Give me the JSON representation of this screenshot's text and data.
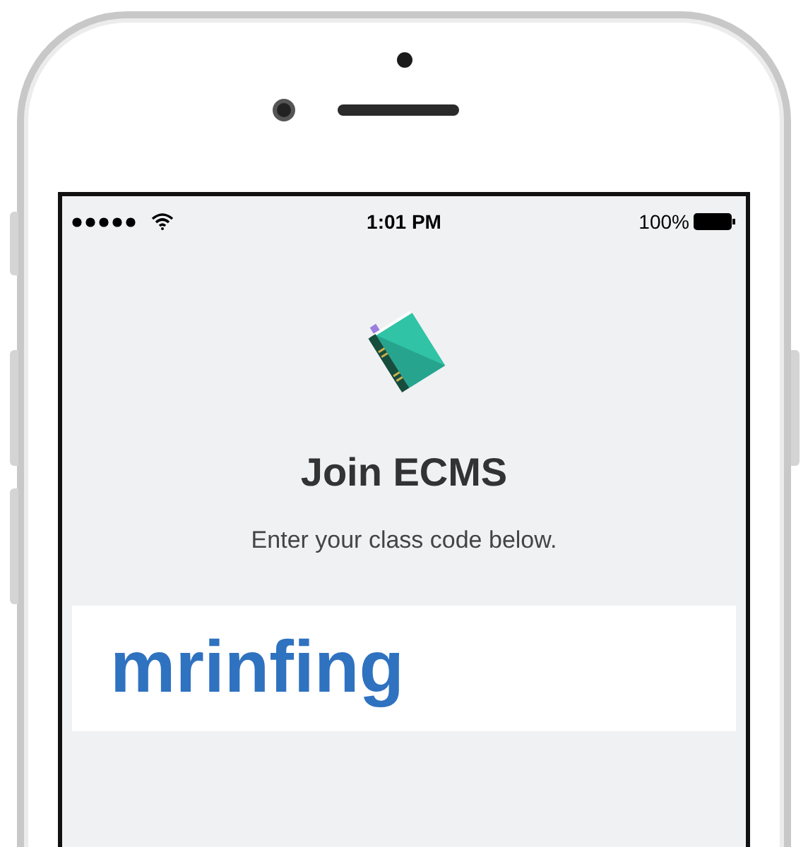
{
  "status_bar": {
    "time": "1:01 PM",
    "battery": "100%"
  },
  "title": "Join ECMS",
  "subtitle": "Enter your class code below.",
  "class_code": {
    "value": "mrinfing"
  }
}
